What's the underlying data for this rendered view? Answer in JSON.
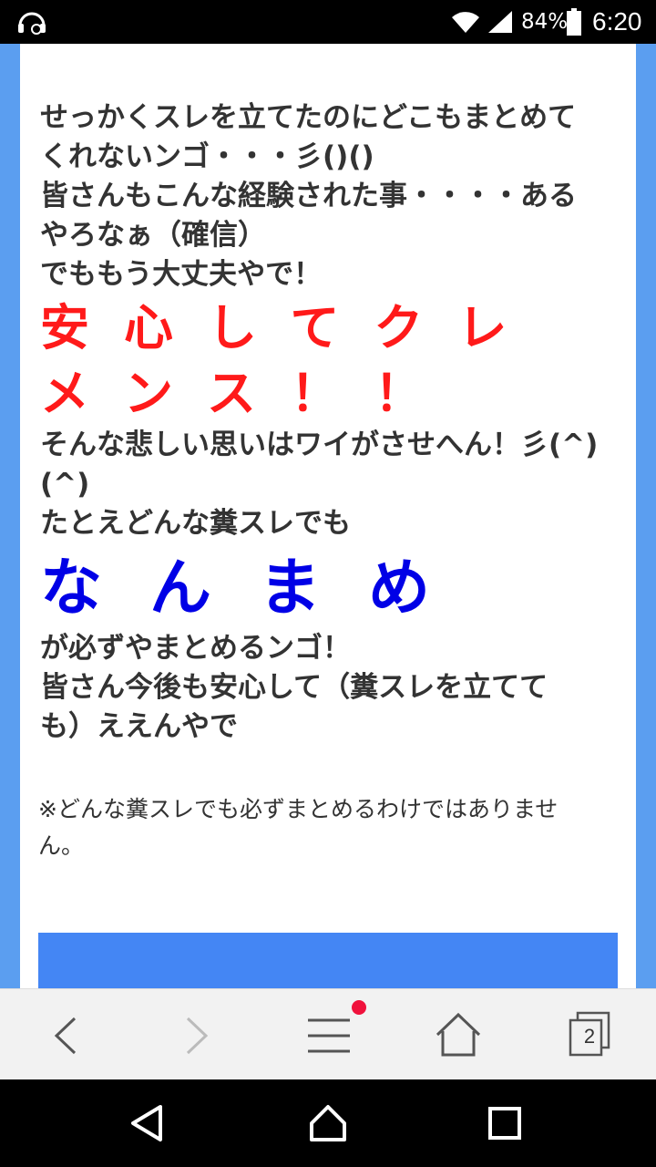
{
  "status_bar": {
    "battery_percent": "84%",
    "time": "6:20"
  },
  "article": {
    "lines_top": [
      "せっかくスレを立てたのにどこもまとめて",
      "くれないンゴ・・・彡()()",
      "皆さんもこんな経験された事・・・・ある",
      "やろなぁ（確信）",
      "でももう大丈夫やで！"
    ],
    "red_line_1": "安心してクレ",
    "red_line_2": "メンス！！",
    "lines_mid": [
      "そんな悲しい思いはワイがさせへん！彡(^)",
      "(^)",
      "たとえどんな糞スレでも"
    ],
    "blue_big": "なんまめ",
    "lines_bottom": [
      "が必ずやまとめるンゴ！",
      "皆さん今後も安心して（糞スレを立てて",
      "も）ええんやで"
    ],
    "note": "※どんな糞スレでも必ずまとめるわけではありませ\nん。",
    "accent_colors": {
      "red": "#ff1a1a",
      "blue": "#0000e6",
      "banner": "#4486f4"
    }
  },
  "toolbar": {
    "tab_count": "2"
  }
}
